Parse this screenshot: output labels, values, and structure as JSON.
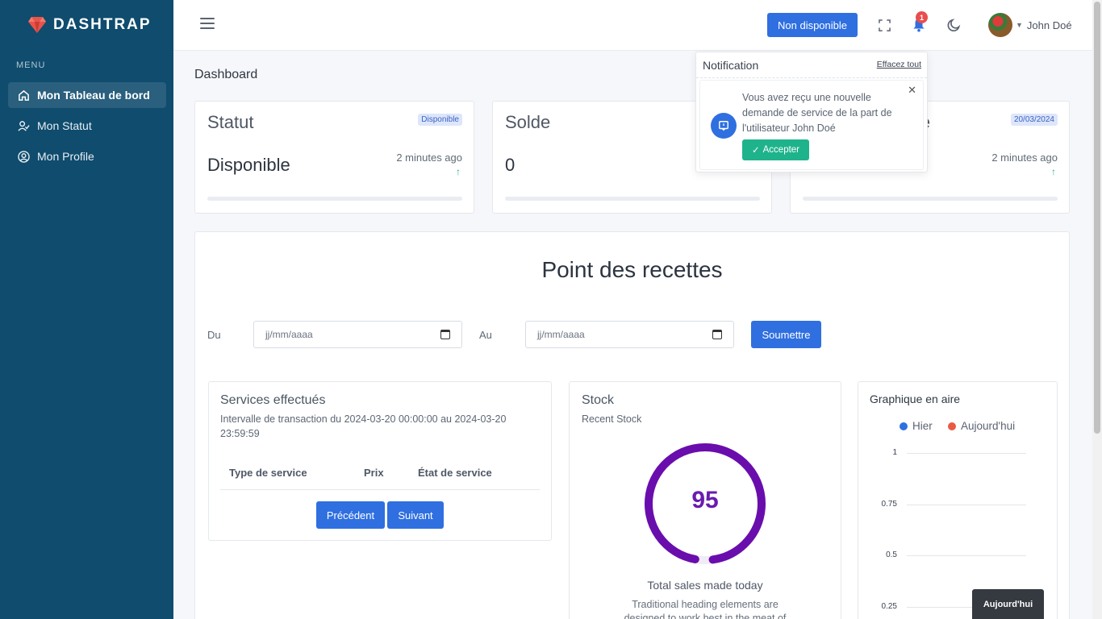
{
  "sidebar": {
    "brand": "DASHTRAP",
    "menu_title": "MENU",
    "items": [
      {
        "label": "Mon Tableau de bord"
      },
      {
        "label": "Mon Statut"
      },
      {
        "label": "Mon Profile"
      }
    ]
  },
  "topbar": {
    "status_button": "Non disponible",
    "notification_count": "1",
    "user_name": "John Doé"
  },
  "page": {
    "title": "Dashboard"
  },
  "stats": [
    {
      "title": "Statut",
      "tag": "Disponible",
      "value": "Disponible",
      "time": "2 minutes ago"
    },
    {
      "title": "Solde",
      "value": "0"
    },
    {
      "title_partial": "ice",
      "tag": "20/03/2024",
      "time": "2 minutes ago"
    }
  ],
  "recettes": {
    "title": "Point des recettes",
    "from_label": "Du",
    "to_label": "Au",
    "date_placeholder": "jj/mm/aaaa",
    "submit": "Soumettre"
  },
  "services": {
    "title": "Services effectués",
    "subtitle_line1": "Intervalle de transaction du 2024-03-20 00:00:00 au 2024-03-20",
    "subtitle_line2": "23:59:59",
    "columns": [
      "Type de service",
      "Prix",
      "État de service"
    ],
    "prev": "Précédent",
    "next": "Suivant"
  },
  "stock": {
    "title": "Stock",
    "subtitle": "Recent Stock",
    "gauge_value": "95",
    "gauge_fraction": 0.95,
    "gauge_color": "#6a0dad",
    "caption": "Total sales made today",
    "description": "Traditional heading elements are designed to work best in the meat of"
  },
  "area_chart": {
    "title": "Graphique en aire",
    "legend": [
      {
        "name": "Hier",
        "color": "#2f6fe0"
      },
      {
        "name": "Aujourd'hui",
        "color": "#ea5a45"
      }
    ],
    "ticks": [
      "1",
      "0.75",
      "0.5",
      "0.25"
    ],
    "tooltip": "Aujourd'hui"
  },
  "notification": {
    "title": "Notification",
    "clear_all": "Effacez tout",
    "message": "Vous avez reçu une nouvelle demande de service de la part de l'utilisateur John Doé",
    "accept": "Accepter"
  }
}
